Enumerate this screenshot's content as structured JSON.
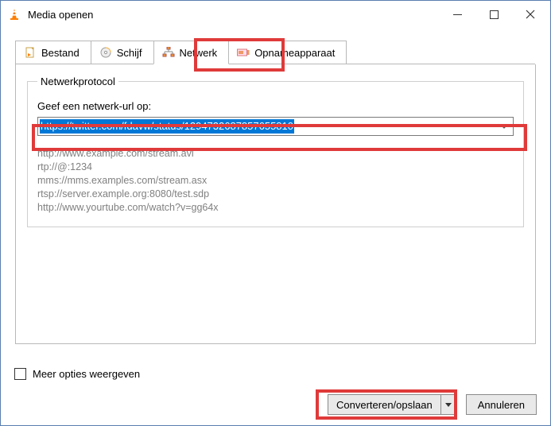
{
  "window": {
    "title": "Media openen"
  },
  "tabs": {
    "file": {
      "label": "Bestand"
    },
    "disc": {
      "label": "Schijf"
    },
    "network": {
      "label": "Netwerk"
    },
    "capture": {
      "label": "Opnameapparaat"
    }
  },
  "network_panel": {
    "legend": "Netwerkprotocol",
    "label": "Geef een netwerk-url op:",
    "url_value": "https://twitter.com/fdavw/status/1294732687857655810",
    "examples": [
      "http://www.example.com/stream.avi",
      "rtp://@:1234",
      "mms://mms.examples.com/stream.asx",
      "rtsp://server.example.org:8080/test.sdp",
      "http://www.yourtube.com/watch?v=gg64x"
    ]
  },
  "footer": {
    "more_options": "Meer opties weergeven",
    "convert": "Converteren/opslaan",
    "cancel": "Annuleren"
  }
}
